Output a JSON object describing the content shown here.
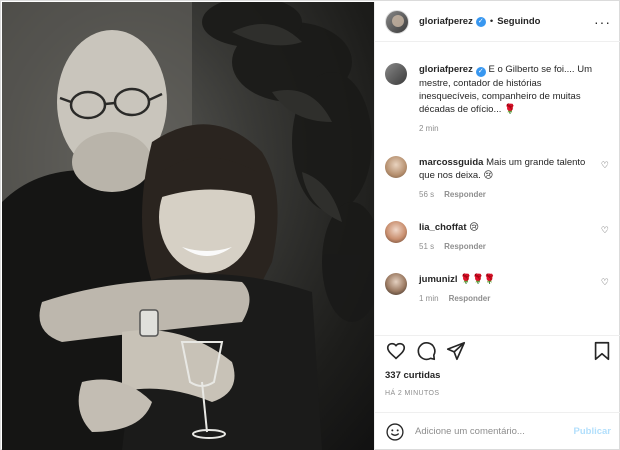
{
  "post": {
    "author": "gloriafperez",
    "follow_status": "Seguindo",
    "caption": "E o Gilberto se foi.... Um mestre, contador de histórias inesquecíveis, companheiro de muitas décadas de ofício... 🌹",
    "caption_time": "2 min"
  },
  "comments": [
    {
      "user": "marcossguida",
      "text": "Mais um grande talento que nos deixa. 😢",
      "time": "56 s",
      "reply": "Responder"
    },
    {
      "user": "lia_choffat",
      "text": "😢",
      "time": "51 s",
      "reply": "Responder"
    },
    {
      "user": "jumunizl",
      "text": "🌹🌹🌹",
      "time": "1 min",
      "reply": "Responder"
    }
  ],
  "stats": {
    "likes": "337 curtidas",
    "time_ago": "HÁ 2 MINUTOS"
  },
  "composer": {
    "placeholder": "Adicione um comentário...",
    "publish": "Publicar"
  },
  "icons": {
    "verified": "verified-badge",
    "more": "more-options-icon",
    "like": "heart-icon",
    "comment": "comment-bubble-icon",
    "share": "paper-plane-icon",
    "save": "bookmark-icon",
    "emoji": "emoji-icon"
  }
}
